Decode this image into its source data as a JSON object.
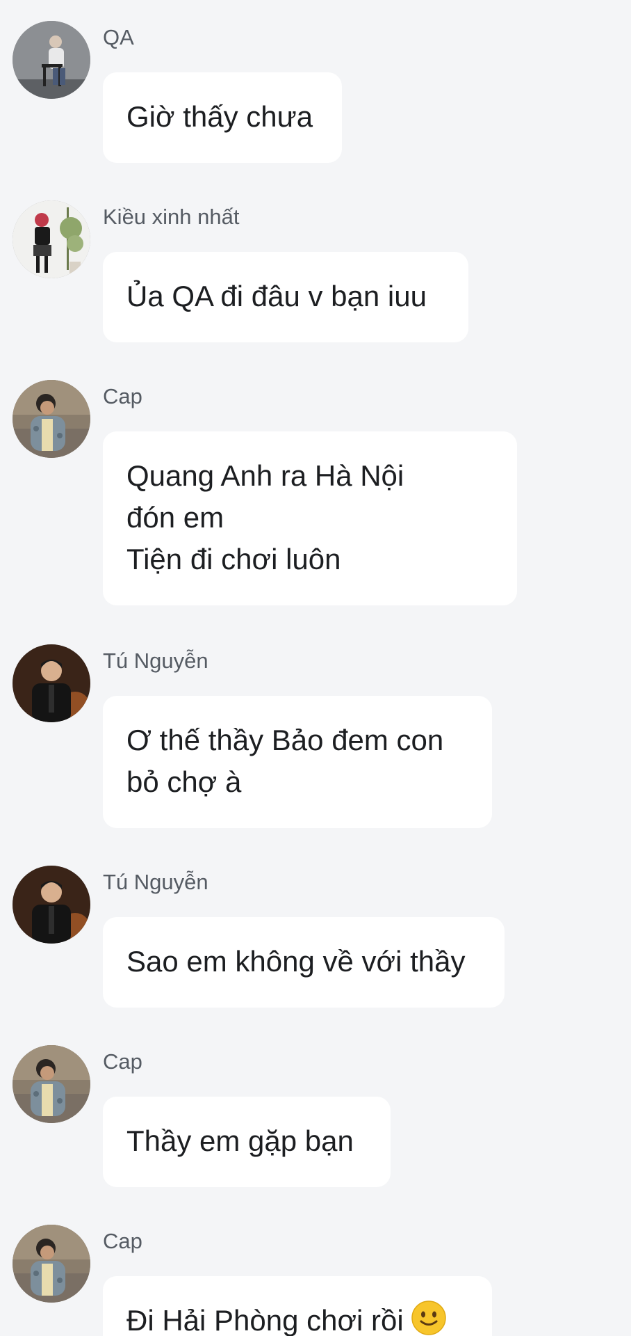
{
  "messages": [
    {
      "sender": "QA",
      "avatar": "avatar-qa",
      "lines": [
        "Giờ thấy chưa"
      ]
    },
    {
      "sender": "Kiều xinh nhất",
      "avatar": "avatar-kieu",
      "lines": [
        "Ủa QA đi đâu v bạn iuu"
      ]
    },
    {
      "sender": "Cap",
      "avatar": "avatar-cap",
      "lines": [
        "Quang Anh ra Hà Nội",
        "đón em",
        "Tiện đi chơi luôn"
      ]
    },
    {
      "sender": "Tú Nguyễn",
      "avatar": "avatar-tu",
      "lines": [
        "Ơ thế thầy Bảo đem con",
        "bỏ chợ à"
      ]
    },
    {
      "sender": "Tú Nguyễn",
      "avatar": "avatar-tu",
      "lines": [
        "Sao em không về với thầy"
      ]
    },
    {
      "sender": "Cap",
      "avatar": "avatar-cap",
      "lines": [
        "Thầy em gặp bạn"
      ]
    },
    {
      "sender": "Cap",
      "avatar": "avatar-cap",
      "lines": [
        "Đi Hải Phòng chơi rồi"
      ],
      "emoji": "slightly-smiling-face-icon"
    }
  ],
  "colors": {
    "background": "#f4f5f7",
    "bubble": "#ffffff",
    "text": "#1c1e21",
    "sender": "#555b63"
  }
}
